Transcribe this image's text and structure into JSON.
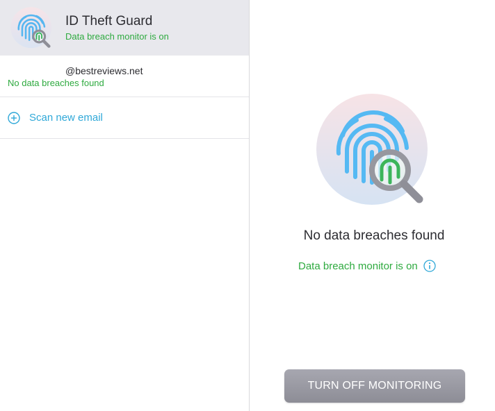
{
  "feature": {
    "title": "ID Theft Guard",
    "status": "Data breach monitor is on"
  },
  "emails": [
    {
      "address": "@bestreviews.net",
      "status": "No data breaches found"
    }
  ],
  "scan_new": {
    "label": "Scan new email"
  },
  "main": {
    "result_title": "No data breaches found",
    "monitor_status": "Data breach monitor is on",
    "toggle_button_label": "TURN OFF MONITORING"
  },
  "icons": {
    "feature": "fingerprint-magnifier-icon",
    "scan": "plus-circle-icon",
    "info": "info-icon"
  },
  "colors": {
    "status_green": "#2eaa3f",
    "accent_blue": "#2fa8d8",
    "header_bg": "#e8e8ed",
    "button_gray": "#9a9aa3"
  }
}
